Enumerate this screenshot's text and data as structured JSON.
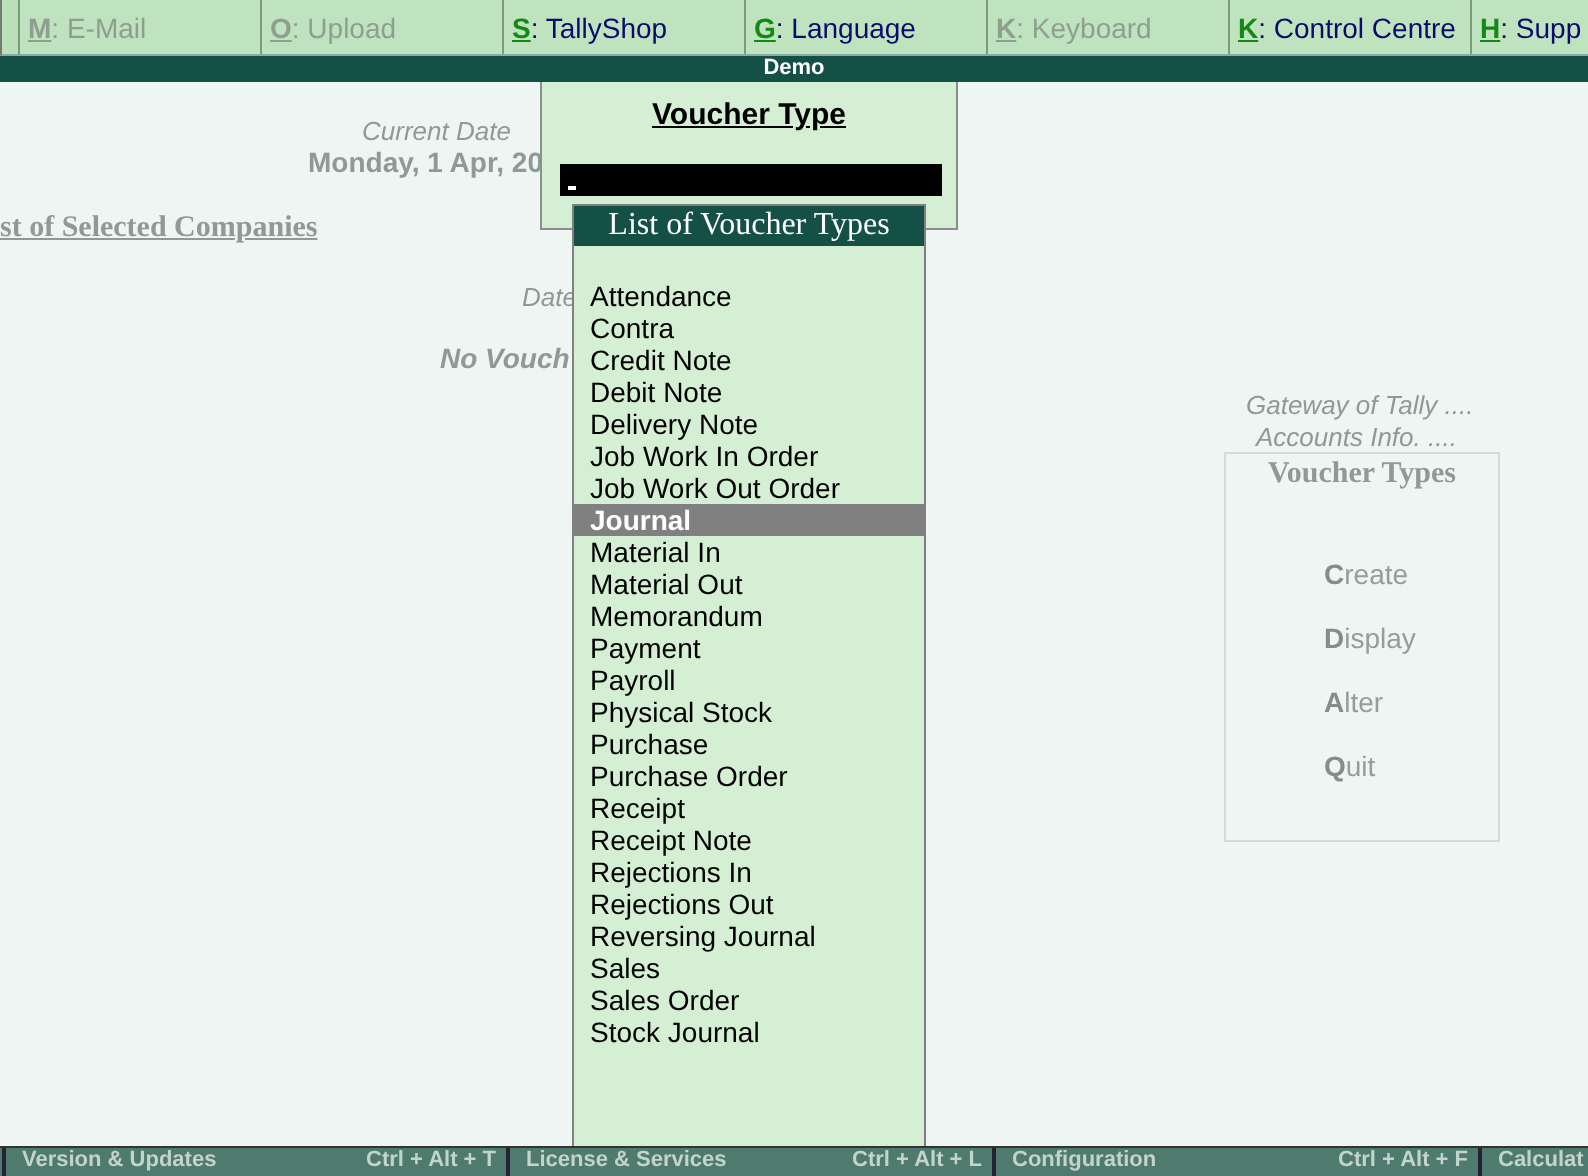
{
  "menu": [
    {
      "key": "M",
      "label": ": E-Mail",
      "disabled": true
    },
    {
      "key": "O",
      "label": ": Upload",
      "disabled": true
    },
    {
      "key": "S",
      "label": ": TallyShop",
      "disabled": false
    },
    {
      "key": "G",
      "label": ": Language",
      "disabled": false
    },
    {
      "key": "K",
      "label": ": Keyboard",
      "disabled": true
    },
    {
      "key": "K",
      "label": ": Control Centre",
      "disabled": false
    },
    {
      "key": "H",
      "label": ": Supp",
      "disabled": false
    }
  ],
  "header_title": "Demo",
  "background": {
    "current_date_label": "Current Date",
    "current_date": "Monday, 1 Apr, 20",
    "companies_title": "st of Selected Companies",
    "date_label": "Date",
    "no_vouchers": "No Vouch"
  },
  "right_menu": {
    "breadcrumbs": [
      "Gateway of Tally ....",
      "Accounts Info. ...."
    ],
    "title": "Voucher Types",
    "items": [
      "**C**reate",
      "**D**isplay",
      "**A**lter",
      "**Q**uit"
    ]
  },
  "voucher_type_panel": {
    "title": "Voucher Type"
  },
  "list": {
    "title": "List of Voucher Types",
    "items": [
      {
        "label": "Attendance",
        "selected": false
      },
      {
        "label": "Contra",
        "selected": false
      },
      {
        "label": "Credit Note",
        "selected": false
      },
      {
        "label": "Debit Note",
        "selected": false
      },
      {
        "label": "Delivery Note",
        "selected": false
      },
      {
        "label": "Job Work In Order",
        "selected": false
      },
      {
        "label": "Job Work Out Order",
        "selected": false
      },
      {
        "label": "Journal",
        "selected": true
      },
      {
        "label": "Material In",
        "selected": false
      },
      {
        "label": "Material Out",
        "selected": false
      },
      {
        "label": "Memorandum",
        "selected": false
      },
      {
        "label": "Payment",
        "selected": false
      },
      {
        "label": "Payroll",
        "selected": false
      },
      {
        "label": "Physical Stock",
        "selected": false
      },
      {
        "label": "Purchase",
        "selected": false
      },
      {
        "label": "Purchase Order",
        "selected": false
      },
      {
        "label": "Receipt",
        "selected": false
      },
      {
        "label": "Receipt Note",
        "selected": false
      },
      {
        "label": "Rejections In",
        "selected": false
      },
      {
        "label": "Rejections Out",
        "selected": false
      },
      {
        "label": "Reversing Journal",
        "selected": false
      },
      {
        "label": "Sales",
        "selected": false
      },
      {
        "label": "Sales Order",
        "selected": false
      },
      {
        "label": "Stock Journal",
        "selected": false
      }
    ]
  },
  "footer": [
    {
      "label": "Version & Updates",
      "shortcut": "Ctrl + Alt + T"
    },
    {
      "label": "License & Services",
      "shortcut": "Ctrl + Alt + L"
    },
    {
      "label": "Configuration",
      "shortcut": "Ctrl + Alt + F"
    },
    {
      "label": "Calculat"
    }
  ]
}
